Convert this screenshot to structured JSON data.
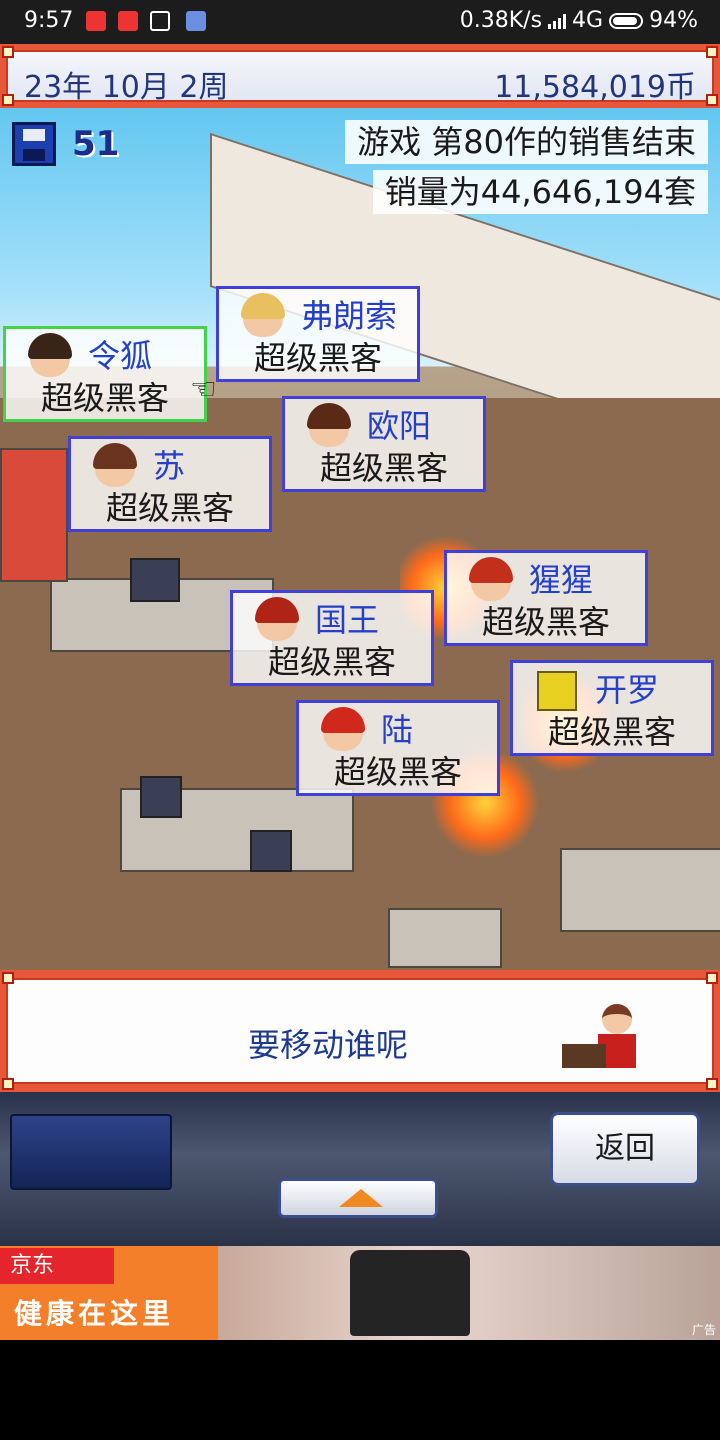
{
  "status_bar": {
    "time": "9:57",
    "network_speed": "0.38K/s",
    "network_type": "4G",
    "battery": "94%"
  },
  "top_bar": {
    "date": "23年 10月 2周",
    "money": "11,584,019币"
  },
  "save": {
    "count": "51"
  },
  "news": {
    "line1": "游戏 第80作的销售结束",
    "line2": "销量为44,646,194套"
  },
  "staff": [
    {
      "name": "令狐",
      "job": "超级黑客",
      "hair": "#3a2418",
      "selected": true
    },
    {
      "name": "弗朗索",
      "job": "超级黑客",
      "hair": "#e8c060",
      "selected": false
    },
    {
      "name": "欧阳",
      "job": "超级黑客",
      "hair": "#5a2a14",
      "selected": false
    },
    {
      "name": "苏",
      "job": "超级黑客",
      "hair": "#6a3420",
      "selected": false
    },
    {
      "name": "猩猩",
      "job": "超级黑客",
      "hair": "#c2301c",
      "selected": false
    },
    {
      "name": "国王",
      "job": "超级黑客",
      "hair": "#b02418",
      "selected": false
    },
    {
      "name": "开罗",
      "job": "超级黑客",
      "hair": "#e8d020",
      "selected": false
    },
    {
      "name": "陆",
      "job": "超级黑客",
      "hair": "#d0281c",
      "selected": false
    }
  ],
  "message": {
    "text": "要移动谁呢"
  },
  "controls": {
    "back_label": "返回"
  },
  "ad": {
    "brand": "京东",
    "slogan": "健康在这里",
    "tag": "广告"
  }
}
